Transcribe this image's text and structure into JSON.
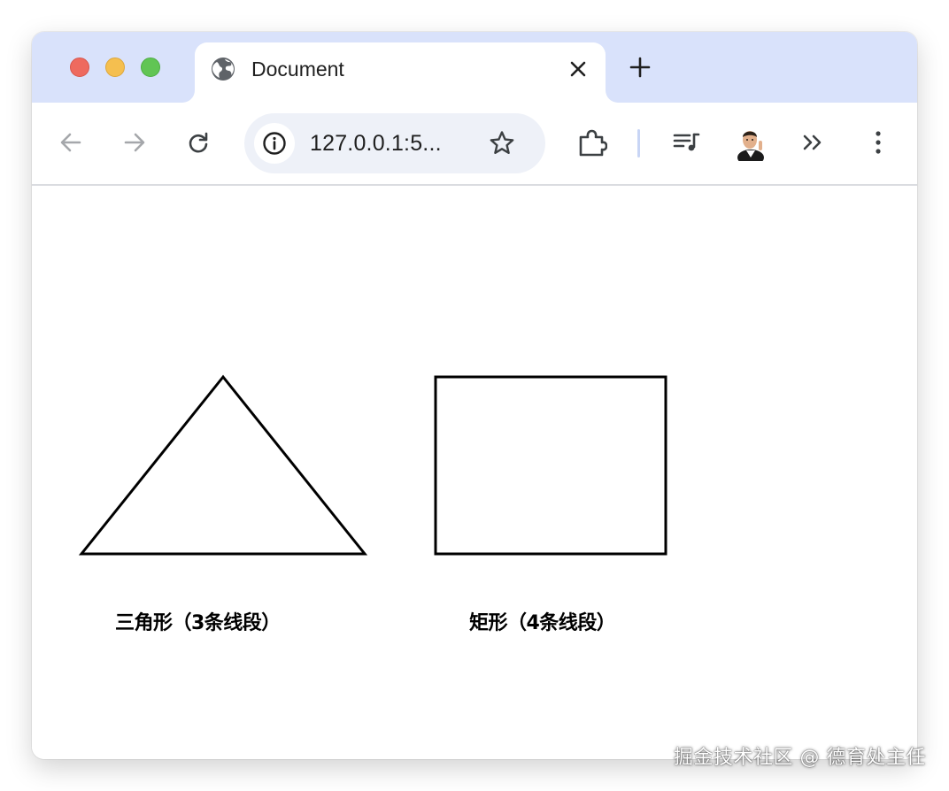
{
  "window": {
    "tab": {
      "title": "Document",
      "favicon": "globe-icon"
    },
    "new_tab_icon": "plus-icon",
    "close_tab_icon": "close-icon"
  },
  "toolbar": {
    "back_icon": "arrow-left-icon",
    "forward_icon": "arrow-right-icon",
    "reload_icon": "reload-icon",
    "omnibox": {
      "info_icon": "info-icon",
      "url": "127.0.0.1:5...",
      "bookmark_icon": "star-icon"
    },
    "extensions_icon": "puzzle-icon",
    "media_icon": "playlist-music-icon",
    "profile": "avatar",
    "overflow_icon": "chevron-double-right-icon",
    "menu_icon": "kebab-menu-icon"
  },
  "page": {
    "shapes": [
      {
        "kind": "triangle",
        "caption": "三角形（3条线段）"
      },
      {
        "kind": "rectangle",
        "caption": "矩形（4条线段）"
      }
    ],
    "stroke_color": "#000000"
  },
  "watermark": "掘金技术社区 @ 德育处主任",
  "colors": {
    "tabstrip": "#d9e2fb",
    "omnibox": "#eef1f8",
    "traffic_red": "#ee6a5f",
    "traffic_yellow": "#f5bf4f",
    "traffic_green": "#61c554"
  }
}
